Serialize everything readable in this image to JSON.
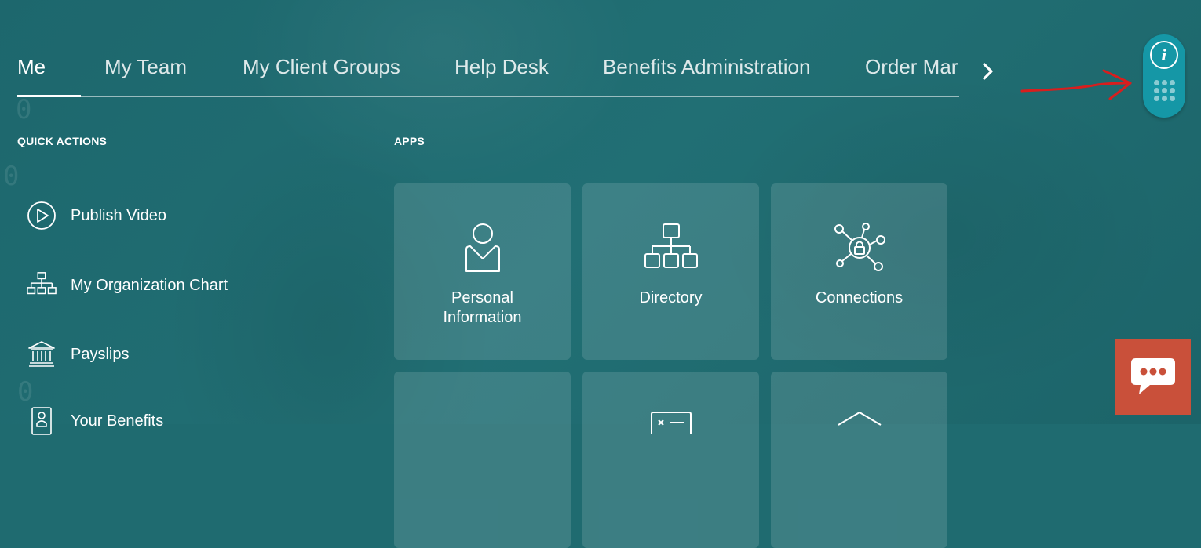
{
  "nav": {
    "tabs": [
      {
        "label": "Me",
        "active": true
      },
      {
        "label": "My Team",
        "active": false
      },
      {
        "label": "My Client Groups",
        "active": false
      },
      {
        "label": "Help Desk",
        "active": false
      },
      {
        "label": "Benefits Administration",
        "active": false
      },
      {
        "label": "Order Mar",
        "active": false
      }
    ]
  },
  "quick_actions": {
    "title": "QUICK ACTIONS",
    "items": [
      {
        "label": "Publish Video",
        "icon": "play-circle-icon"
      },
      {
        "label": "My Organization Chart",
        "icon": "org-chart-icon"
      },
      {
        "label": "Payslips",
        "icon": "bank-icon"
      },
      {
        "label": "Your Benefits",
        "icon": "id-badge-icon"
      }
    ]
  },
  "apps": {
    "title": "APPS",
    "tiles": [
      {
        "label": "Personal\nInformation",
        "icon": "person-icon"
      },
      {
        "label": "Directory",
        "icon": "directory-icon"
      },
      {
        "label": "Connections",
        "icon": "connections-icon"
      }
    ]
  },
  "toolbar": {
    "info_icon": "info-icon",
    "grid_icon": "apps-grid-icon"
  },
  "colors": {
    "background": "#1f6b70",
    "pill": "#1597a6",
    "chat": "#c9503a",
    "annotation_arrow": "#d81e1e"
  }
}
